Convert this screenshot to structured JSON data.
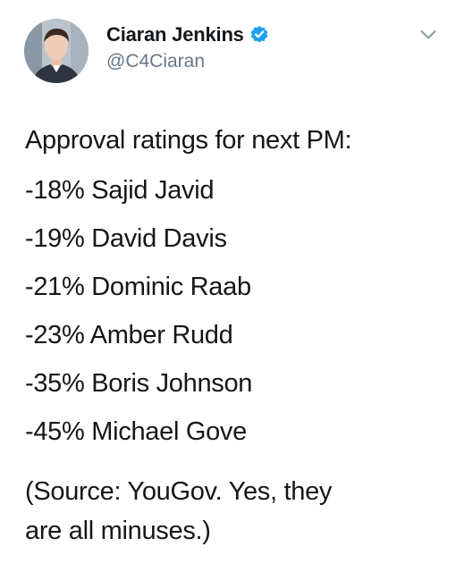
{
  "author": {
    "display_name": "Ciaran Jenkins",
    "handle": "@C4Ciaran",
    "verified": true,
    "avatar_icon": "profile-photo"
  },
  "menu": {
    "icon": "chevron-down-icon"
  },
  "tweet": {
    "heading": "Approval ratings for next PM:",
    "ratings": [
      "-18% Sajid Javid",
      "-19% David Davis",
      "-21% Dominic Raab",
      "-23% Amber Rudd",
      "-35% Boris Johnson",
      "-45% Michael Gove"
    ],
    "source_line1": "(Source: YouGov. Yes, they",
    "source_line2": "are all minuses.)"
  },
  "colors": {
    "text": "#14171a",
    "secondary": "#657786",
    "verified_blue": "#1da1f2"
  }
}
